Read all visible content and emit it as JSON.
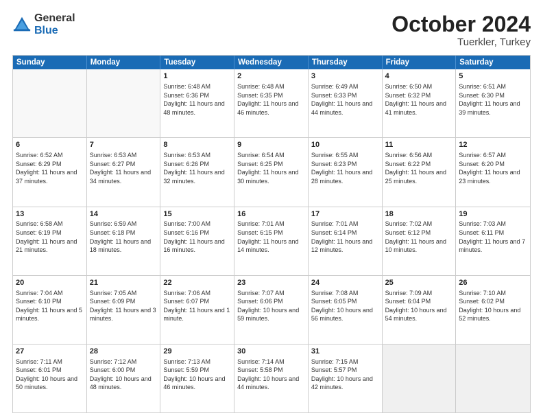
{
  "logo": {
    "general": "General",
    "blue": "Blue"
  },
  "title": "October 2024",
  "subtitle": "Tuerkler, Turkey",
  "header_days": [
    "Sunday",
    "Monday",
    "Tuesday",
    "Wednesday",
    "Thursday",
    "Friday",
    "Saturday"
  ],
  "weeks": [
    [
      {
        "day": "",
        "sunrise": "",
        "sunset": "",
        "daylight": "",
        "empty": true
      },
      {
        "day": "",
        "sunrise": "",
        "sunset": "",
        "daylight": "",
        "empty": true
      },
      {
        "day": "1",
        "sunrise": "Sunrise: 6:48 AM",
        "sunset": "Sunset: 6:36 PM",
        "daylight": "Daylight: 11 hours and 48 minutes."
      },
      {
        "day": "2",
        "sunrise": "Sunrise: 6:48 AM",
        "sunset": "Sunset: 6:35 PM",
        "daylight": "Daylight: 11 hours and 46 minutes."
      },
      {
        "day": "3",
        "sunrise": "Sunrise: 6:49 AM",
        "sunset": "Sunset: 6:33 PM",
        "daylight": "Daylight: 11 hours and 44 minutes."
      },
      {
        "day": "4",
        "sunrise": "Sunrise: 6:50 AM",
        "sunset": "Sunset: 6:32 PM",
        "daylight": "Daylight: 11 hours and 41 minutes."
      },
      {
        "day": "5",
        "sunrise": "Sunrise: 6:51 AM",
        "sunset": "Sunset: 6:30 PM",
        "daylight": "Daylight: 11 hours and 39 minutes."
      }
    ],
    [
      {
        "day": "6",
        "sunrise": "Sunrise: 6:52 AM",
        "sunset": "Sunset: 6:29 PM",
        "daylight": "Daylight: 11 hours and 37 minutes."
      },
      {
        "day": "7",
        "sunrise": "Sunrise: 6:53 AM",
        "sunset": "Sunset: 6:27 PM",
        "daylight": "Daylight: 11 hours and 34 minutes."
      },
      {
        "day": "8",
        "sunrise": "Sunrise: 6:53 AM",
        "sunset": "Sunset: 6:26 PM",
        "daylight": "Daylight: 11 hours and 32 minutes."
      },
      {
        "day": "9",
        "sunrise": "Sunrise: 6:54 AM",
        "sunset": "Sunset: 6:25 PM",
        "daylight": "Daylight: 11 hours and 30 minutes."
      },
      {
        "day": "10",
        "sunrise": "Sunrise: 6:55 AM",
        "sunset": "Sunset: 6:23 PM",
        "daylight": "Daylight: 11 hours and 28 minutes."
      },
      {
        "day": "11",
        "sunrise": "Sunrise: 6:56 AM",
        "sunset": "Sunset: 6:22 PM",
        "daylight": "Daylight: 11 hours and 25 minutes."
      },
      {
        "day": "12",
        "sunrise": "Sunrise: 6:57 AM",
        "sunset": "Sunset: 6:20 PM",
        "daylight": "Daylight: 11 hours and 23 minutes."
      }
    ],
    [
      {
        "day": "13",
        "sunrise": "Sunrise: 6:58 AM",
        "sunset": "Sunset: 6:19 PM",
        "daylight": "Daylight: 11 hours and 21 minutes."
      },
      {
        "day": "14",
        "sunrise": "Sunrise: 6:59 AM",
        "sunset": "Sunset: 6:18 PM",
        "daylight": "Daylight: 11 hours and 18 minutes."
      },
      {
        "day": "15",
        "sunrise": "Sunrise: 7:00 AM",
        "sunset": "Sunset: 6:16 PM",
        "daylight": "Daylight: 11 hours and 16 minutes."
      },
      {
        "day": "16",
        "sunrise": "Sunrise: 7:01 AM",
        "sunset": "Sunset: 6:15 PM",
        "daylight": "Daylight: 11 hours and 14 minutes."
      },
      {
        "day": "17",
        "sunrise": "Sunrise: 7:01 AM",
        "sunset": "Sunset: 6:14 PM",
        "daylight": "Daylight: 11 hours and 12 minutes."
      },
      {
        "day": "18",
        "sunrise": "Sunrise: 7:02 AM",
        "sunset": "Sunset: 6:12 PM",
        "daylight": "Daylight: 11 hours and 10 minutes."
      },
      {
        "day": "19",
        "sunrise": "Sunrise: 7:03 AM",
        "sunset": "Sunset: 6:11 PM",
        "daylight": "Daylight: 11 hours and 7 minutes."
      }
    ],
    [
      {
        "day": "20",
        "sunrise": "Sunrise: 7:04 AM",
        "sunset": "Sunset: 6:10 PM",
        "daylight": "Daylight: 11 hours and 5 minutes."
      },
      {
        "day": "21",
        "sunrise": "Sunrise: 7:05 AM",
        "sunset": "Sunset: 6:09 PM",
        "daylight": "Daylight: 11 hours and 3 minutes."
      },
      {
        "day": "22",
        "sunrise": "Sunrise: 7:06 AM",
        "sunset": "Sunset: 6:07 PM",
        "daylight": "Daylight: 11 hours and 1 minute."
      },
      {
        "day": "23",
        "sunrise": "Sunrise: 7:07 AM",
        "sunset": "Sunset: 6:06 PM",
        "daylight": "Daylight: 10 hours and 59 minutes."
      },
      {
        "day": "24",
        "sunrise": "Sunrise: 7:08 AM",
        "sunset": "Sunset: 6:05 PM",
        "daylight": "Daylight: 10 hours and 56 minutes."
      },
      {
        "day": "25",
        "sunrise": "Sunrise: 7:09 AM",
        "sunset": "Sunset: 6:04 PM",
        "daylight": "Daylight: 10 hours and 54 minutes."
      },
      {
        "day": "26",
        "sunrise": "Sunrise: 7:10 AM",
        "sunset": "Sunset: 6:02 PM",
        "daylight": "Daylight: 10 hours and 52 minutes."
      }
    ],
    [
      {
        "day": "27",
        "sunrise": "Sunrise: 7:11 AM",
        "sunset": "Sunset: 6:01 PM",
        "daylight": "Daylight: 10 hours and 50 minutes."
      },
      {
        "day": "28",
        "sunrise": "Sunrise: 7:12 AM",
        "sunset": "Sunset: 6:00 PM",
        "daylight": "Daylight: 10 hours and 48 minutes."
      },
      {
        "day": "29",
        "sunrise": "Sunrise: 7:13 AM",
        "sunset": "Sunset: 5:59 PM",
        "daylight": "Daylight: 10 hours and 46 minutes."
      },
      {
        "day": "30",
        "sunrise": "Sunrise: 7:14 AM",
        "sunset": "Sunset: 5:58 PM",
        "daylight": "Daylight: 10 hours and 44 minutes."
      },
      {
        "day": "31",
        "sunrise": "Sunrise: 7:15 AM",
        "sunset": "Sunset: 5:57 PM",
        "daylight": "Daylight: 10 hours and 42 minutes."
      },
      {
        "day": "",
        "sunrise": "",
        "sunset": "",
        "daylight": "",
        "empty": true,
        "shaded": true
      },
      {
        "day": "",
        "sunrise": "",
        "sunset": "",
        "daylight": "",
        "empty": true,
        "shaded": true
      }
    ]
  ]
}
